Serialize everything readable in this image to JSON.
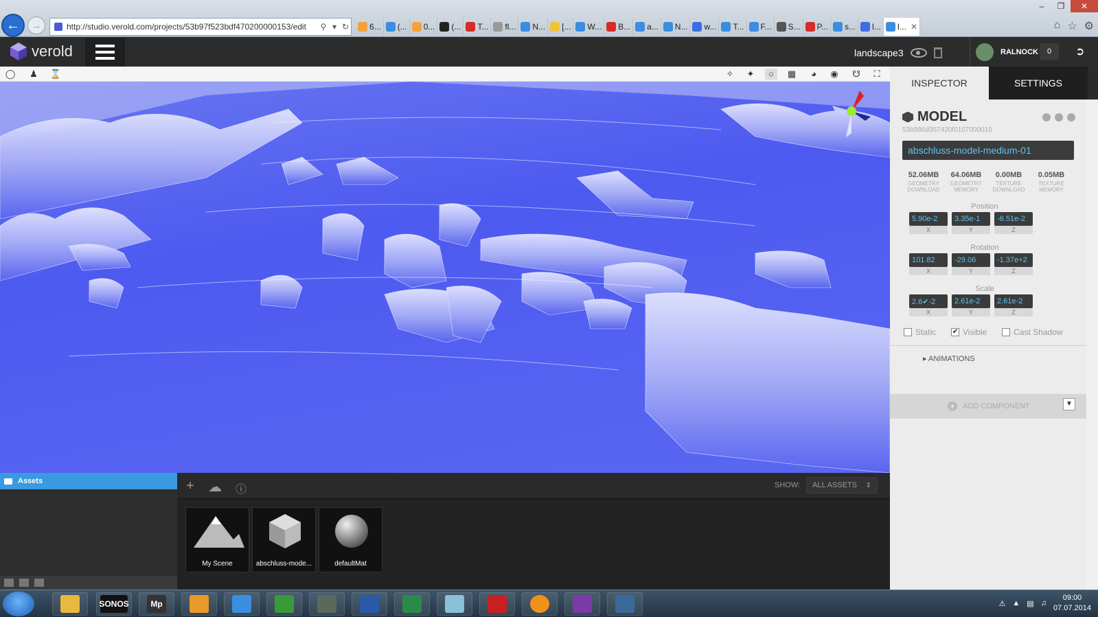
{
  "browser": {
    "url": "http://studio.verold.com/projects/53b97f523bdf470200000153/edit",
    "tabs": [
      {
        "label": "6...",
        "color": "#f2a23a"
      },
      {
        "label": "(...",
        "color": "#3b8de0"
      },
      {
        "label": "0...",
        "color": "#f2a23a"
      },
      {
        "label": "(...",
        "color": "#222222"
      },
      {
        "label": "T...",
        "color": "#d62b2b"
      },
      {
        "label": "fl...",
        "color": "#999999"
      },
      {
        "label": "N...",
        "color": "#3b8de0"
      },
      {
        "label": "[...",
        "color": "#f2c23a"
      },
      {
        "label": "W...",
        "color": "#3b8de0"
      },
      {
        "label": "B...",
        "color": "#d62b2b"
      },
      {
        "label": "a...",
        "color": "#3b8de0"
      },
      {
        "label": "N...",
        "color": "#3b8de0"
      },
      {
        "label": "w...",
        "color": "#3b6ee0"
      },
      {
        "label": "T...",
        "color": "#3b8de0"
      },
      {
        "label": "F...",
        "color": "#3b8de0"
      },
      {
        "label": "S...",
        "color": "#555555"
      },
      {
        "label": "P...",
        "color": "#d62b2b"
      },
      {
        "label": "s...",
        "color": "#3b8de0"
      },
      {
        "label": "l...",
        "color": "#3b6ee0"
      },
      {
        "label": "I...",
        "color": "#3b8de0"
      }
    ]
  },
  "app": {
    "logo_text": "verold",
    "project_name": "landscape3",
    "user_name": "RALNOCK",
    "notification_count": "0"
  },
  "inspector": {
    "tab_inspector": "INSPECTOR",
    "tab_settings": "SETTINGS",
    "title": "MODEL",
    "model_id": "53b986d357420f0107000010",
    "name": "abschluss-model-medium-01",
    "stats": [
      {
        "value": "52.06MB",
        "label1": "GEOMETRY",
        "label2": "DOWNLOAD"
      },
      {
        "value": "64.06MB",
        "label1": "GEOMETRY",
        "label2": "MEMORY"
      },
      {
        "value": "0.00MB",
        "label1": "TEXTURE",
        "label2": "DOWNLOAD"
      },
      {
        "value": "0.05MB",
        "label1": "TEXTURE",
        "label2": "MEMORY"
      }
    ],
    "position": {
      "label": "Position",
      "x": "5.90e-2",
      "y": "3.35e-1",
      "z": "-6.51e-2"
    },
    "rotation": {
      "label": "Rotation",
      "x": "101.82",
      "y": "-29.06",
      "z": "-1.37e+2"
    },
    "scale": {
      "label": "Scale",
      "x": "2.6✔-2",
      "y": "2.61e-2",
      "z": "2.61e-2"
    },
    "axis_x": "X",
    "axis_y": "Y",
    "axis_z": "Z",
    "static_label": "Static",
    "visible_label": "Visible",
    "cast_shadow_label": "Cast Shadow",
    "static_checked": false,
    "visible_checked": true,
    "cast_shadow_checked": false,
    "animations_label": "ANIMATIONS",
    "add_component_label": "ADD COMPONENT"
  },
  "assets": {
    "header": "Assets",
    "show_label": "SHOW:",
    "show_value": "ALL ASSETS",
    "items": [
      {
        "label": "My Scene",
        "kind": "scene-icon"
      },
      {
        "label": "abschluss-mode...",
        "kind": "model-icon"
      },
      {
        "label": "defaultMat",
        "kind": "material-icon"
      }
    ]
  },
  "taskbar": {
    "time": "09:00",
    "date": "07.07.2014",
    "apps": [
      "SONOS",
      "Mp"
    ]
  }
}
